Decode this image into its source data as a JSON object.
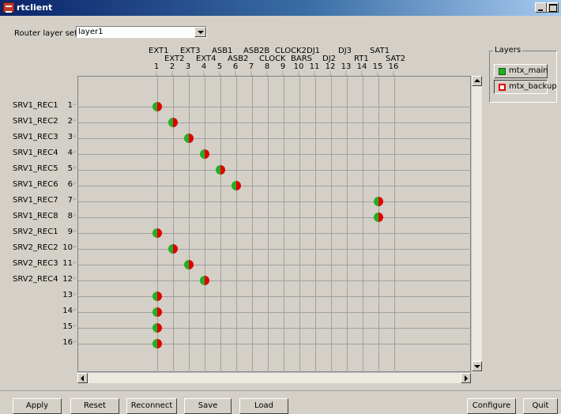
{
  "window": {
    "title": "rtclient"
  },
  "router_layer_set": {
    "label": "Router layer set:",
    "value": "layer1"
  },
  "columns": [
    {
      "num": "1",
      "name": "EXT1",
      "row": 1
    },
    {
      "num": "2",
      "name": "EXT2",
      "row": 2
    },
    {
      "num": "3",
      "name": "EXT3",
      "row": 1
    },
    {
      "num": "4",
      "name": "EXT4",
      "row": 2
    },
    {
      "num": "5",
      "name": "ASB1",
      "row": 1
    },
    {
      "num": "6",
      "name": "ASB2",
      "row": 2
    },
    {
      "num": "7",
      "name": "ASB2B",
      "row": 1
    },
    {
      "num": "8",
      "name": "CLOCK",
      "row": 2
    },
    {
      "num": "9",
      "name": "CLOCK2",
      "row": 1
    },
    {
      "num": "10",
      "name": "BARS",
      "row": 2
    },
    {
      "num": "11",
      "name": "DJ1",
      "row": 1
    },
    {
      "num": "12",
      "name": "DJ2",
      "row": 2
    },
    {
      "num": "13",
      "name": "DJ3",
      "row": 1
    },
    {
      "num": "14",
      "name": "RT1",
      "row": 2
    },
    {
      "num": "15",
      "name": "SAT1",
      "row": 1
    },
    {
      "num": "16",
      "name": "SAT2",
      "row": 2
    }
  ],
  "rows": [
    {
      "name": "SRV1_REC1",
      "num": "1",
      "col": 1
    },
    {
      "name": "SRV1_REC2",
      "num": "2",
      "col": 2
    },
    {
      "name": "SRV1_REC3",
      "num": "3",
      "col": 3
    },
    {
      "name": "SRV1_REC4",
      "num": "4",
      "col": 4
    },
    {
      "name": "SRV1_REC5",
      "num": "5",
      "col": 5
    },
    {
      "name": "SRV1_REC6",
      "num": "6",
      "col": 6
    },
    {
      "name": "SRV1_REC7",
      "num": "7",
      "col": 15
    },
    {
      "name": "SRV1_REC8",
      "num": "8",
      "col": 15
    },
    {
      "name": "SRV2_REC1",
      "num": "9",
      "col": 1
    },
    {
      "name": "SRV2_REC2",
      "num": "10",
      "col": 2
    },
    {
      "name": "SRV2_REC3",
      "num": "11",
      "col": 3
    },
    {
      "name": "SRV2_REC4",
      "num": "12",
      "col": 4
    },
    {
      "name": "",
      "num": "13",
      "col": 1
    },
    {
      "name": "",
      "num": "14",
      "col": 1
    },
    {
      "name": "",
      "num": "15",
      "col": 1
    },
    {
      "name": "",
      "num": "16",
      "col": 1
    }
  ],
  "layers": {
    "title": "Layers",
    "items": [
      {
        "label": "mtx_main",
        "color": "#22b022"
      },
      {
        "label": "mtx_backup",
        "color": "#e00000"
      }
    ]
  },
  "crosspoint_colors": {
    "left": "#22b022",
    "right": "#e00000"
  },
  "buttons": {
    "apply": "Apply",
    "reset": "Reset",
    "reconnect": "Reconnect",
    "save": "Save",
    "load": "Load",
    "configure": "Configure",
    "quit": "Quit"
  }
}
